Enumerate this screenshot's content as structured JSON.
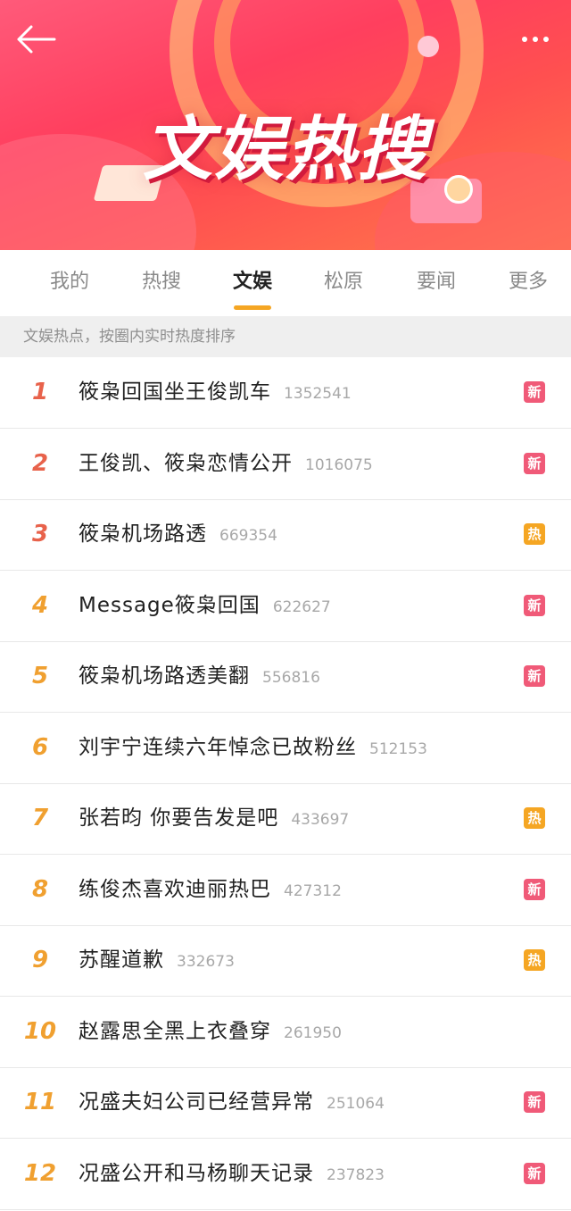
{
  "header": {
    "banner_title": "文娱热搜",
    "back_icon": "arrow-left-icon",
    "more_icon": "more-dots-icon"
  },
  "tabs": [
    {
      "label": "我的",
      "active": false
    },
    {
      "label": "热搜",
      "active": false
    },
    {
      "label": "文娱",
      "active": true
    },
    {
      "label": "松原",
      "active": false
    },
    {
      "label": "要闻",
      "active": false
    },
    {
      "label": "更多",
      "active": false
    }
  ],
  "notice": "文娱热点，按圈内实时热度排序",
  "colors": {
    "rank_top": "#e8624b",
    "rank_other": "#f0a030",
    "badge_new": "#f05a78",
    "badge_hot": "#f5a623",
    "tab_accent": "#f5a623"
  },
  "items": [
    {
      "rank": "1",
      "title": "筱枭回国坐王俊凯车",
      "count": "1352541",
      "badge": "新",
      "badge_type": "new"
    },
    {
      "rank": "2",
      "title": "王俊凯、筱枭恋情公开",
      "count": "1016075",
      "badge": "新",
      "badge_type": "new"
    },
    {
      "rank": "3",
      "title": "筱枭机场路透",
      "count": "669354",
      "badge": "热",
      "badge_type": "hot"
    },
    {
      "rank": "4",
      "title": "Message筱枭回国",
      "count": "622627",
      "badge": "新",
      "badge_type": "new"
    },
    {
      "rank": "5",
      "title": "筱枭机场路透美翻",
      "count": "556816",
      "badge": "新",
      "badge_type": "new"
    },
    {
      "rank": "6",
      "title": "刘宇宁连续六年悼念已故粉丝",
      "count": "512153",
      "badge": "",
      "badge_type": ""
    },
    {
      "rank": "7",
      "title": "张若昀 你要告发是吧",
      "count": "433697",
      "badge": "热",
      "badge_type": "hot"
    },
    {
      "rank": "8",
      "title": "练俊杰喜欢迪丽热巴",
      "count": "427312",
      "badge": "新",
      "badge_type": "new"
    },
    {
      "rank": "9",
      "title": "苏醒道歉",
      "count": "332673",
      "badge": "热",
      "badge_type": "hot"
    },
    {
      "rank": "10",
      "title": "赵露思全黑上衣叠穿",
      "count": "261950",
      "badge": "",
      "badge_type": ""
    },
    {
      "rank": "11",
      "title": "况盛夫妇公司已经营异常",
      "count": "251064",
      "badge": "新",
      "badge_type": "new"
    },
    {
      "rank": "12",
      "title": "况盛公开和马杨聊天记录",
      "count": "237823",
      "badge": "新",
      "badge_type": "new"
    }
  ]
}
